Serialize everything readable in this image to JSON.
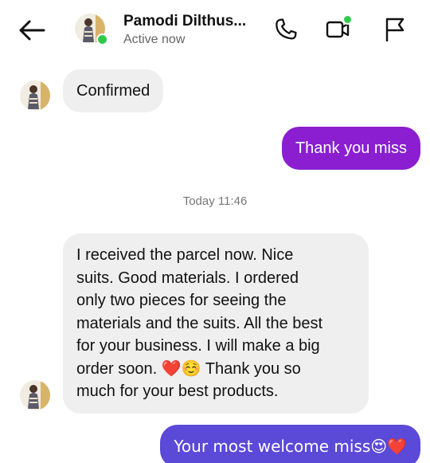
{
  "header": {
    "contact_name": "Pamodi Dilthus...",
    "status": "Active now",
    "back_icon": "back-arrow-icon",
    "call_icon": "phone-icon",
    "video_icon": "video-camera-icon",
    "flag_icon": "flag-icon"
  },
  "messages": [
    {
      "direction": "incoming",
      "text": "Confirmed"
    },
    {
      "direction": "outgoing",
      "text": "Thank you miss"
    },
    {
      "direction": "incoming",
      "lines": [
        "I received the parcel now. Nice",
        "suits. Good materials. I ordered",
        "only two pieces for seeing the",
        "materials and the suits. All the best",
        "for your business. I will make a big",
        "order soon.   ❤️☺️ Thank you so",
        "much for your best products."
      ]
    },
    {
      "direction": "outgoing",
      "text": "Your most welcome miss😍❤️"
    }
  ],
  "timestamp": "Today 11:46",
  "colors": {
    "online": "#31c94a",
    "incoming_bubble": "#efefef",
    "outgoing_bubble_top": "#8e1ed0",
    "outgoing_bubble_bottom": "#5b49d8"
  }
}
